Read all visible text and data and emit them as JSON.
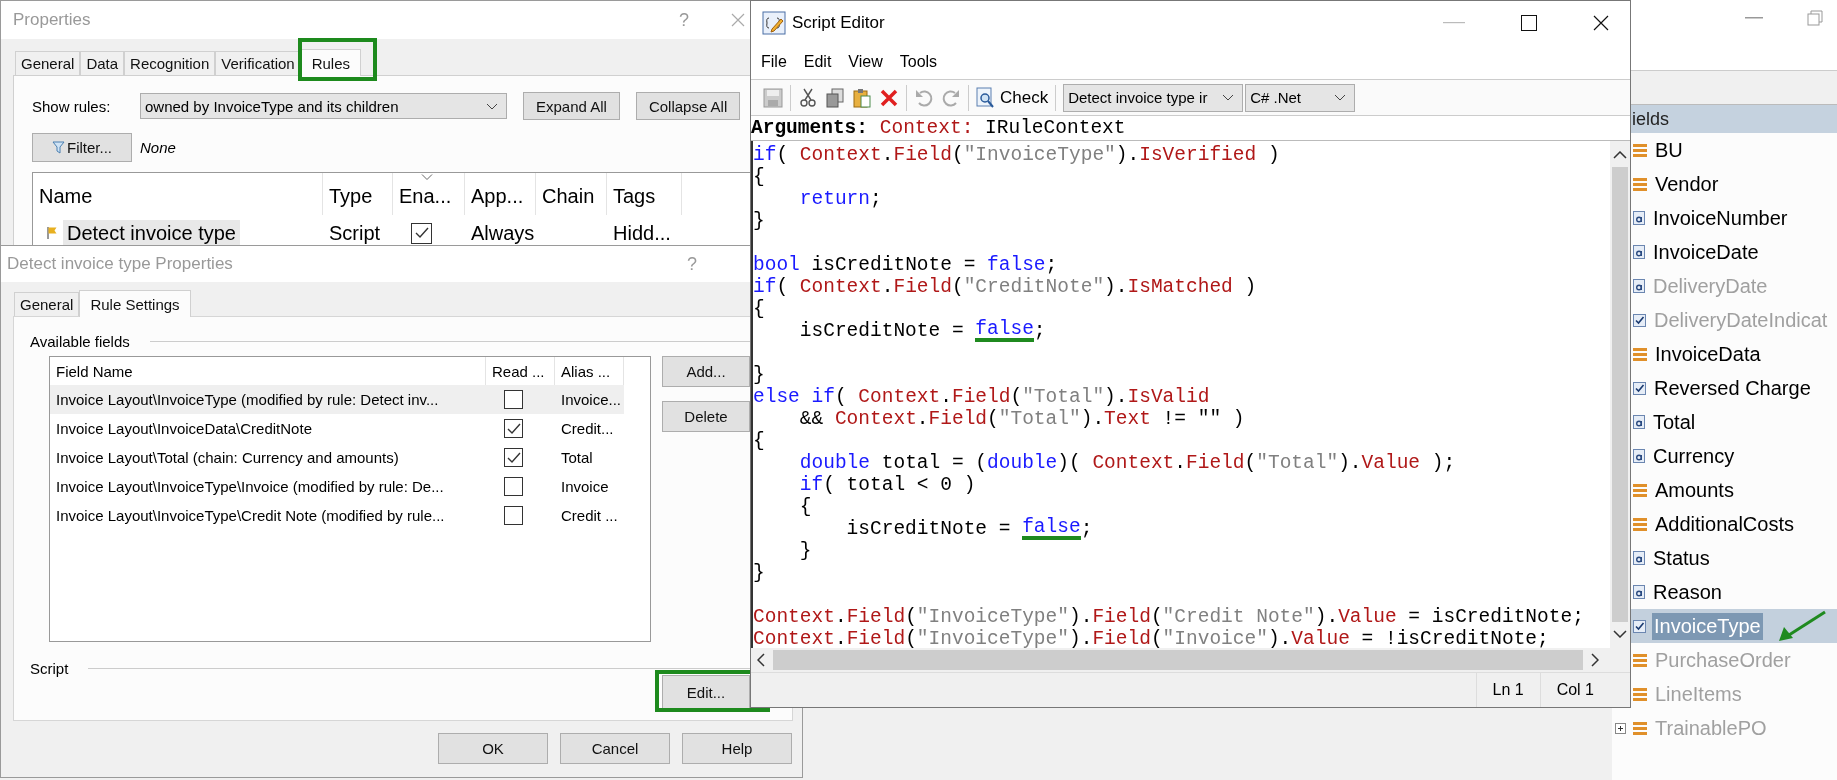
{
  "properties_window": {
    "title": "Properties",
    "help": "?",
    "tabs": [
      {
        "label": "General",
        "selected": false,
        "highlighted": false
      },
      {
        "label": "Data",
        "selected": false,
        "highlighted": false
      },
      {
        "label": "Recognition",
        "selected": false,
        "highlighted": false
      },
      {
        "label": "Verification",
        "selected": false,
        "highlighted": false
      },
      {
        "label": "Rules",
        "selected": true,
        "highlighted": true
      }
    ],
    "show_rules_label": "Show rules:",
    "show_rules_value": "owned by InvoiceType and its children",
    "buttons": [
      "Expand All",
      "Collapse All"
    ],
    "filter_button": "Filter...",
    "filter_value": "None",
    "rules_table": {
      "columns": [
        {
          "label": "Name",
          "sorted": false
        },
        {
          "label": "Type",
          "sorted": false
        },
        {
          "label": "Ena...",
          "sorted": true
        },
        {
          "label": "App...",
          "sorted": false
        },
        {
          "label": "Chain",
          "sorted": false
        },
        {
          "label": "Tags",
          "sorted": false
        }
      ],
      "rows": [
        {
          "name": "Detect invoice type",
          "type": "Script",
          "enabled": true,
          "applies": "Always",
          "tags": "Hidd...",
          "selected": true
        }
      ]
    }
  },
  "detect_dialog": {
    "title": "Detect invoice type Properties",
    "help": "?",
    "tabs": [
      {
        "label": "General",
        "selected": false
      },
      {
        "label": "Rule Settings",
        "selected": true
      }
    ],
    "available_fields_label": "Available fields",
    "fields_table": {
      "columns": [
        "Field Name",
        "Read ...",
        "Alias ..."
      ],
      "rows": [
        {
          "field_name": "Invoice Layout\\InvoiceType (modified by rule: Detect inv...",
          "read_only": false,
          "alias": "Invoice...",
          "selected": true
        },
        {
          "field_name": "Invoice Layout\\InvoiceData\\CreditNote",
          "read_only": true,
          "alias": "Credit...",
          "selected": false
        },
        {
          "field_name": "Invoice Layout\\Total (chain: Currency and amounts)",
          "read_only": true,
          "alias": "Total",
          "selected": false
        },
        {
          "field_name": "Invoice Layout\\InvoiceType\\Invoice (modified by rule: De...",
          "read_only": false,
          "alias": "Invoice",
          "selected": false
        },
        {
          "field_name": "Invoice Layout\\InvoiceType\\Credit Note (modified by rule...",
          "read_only": false,
          "alias": "Credit ...",
          "selected": false
        }
      ]
    },
    "add_button": "Add...",
    "delete_button": "Delete",
    "script_label": "Script",
    "edit_button": {
      "label": "Edit...",
      "highlighted": true
    },
    "footer_buttons": [
      "OK",
      "Cancel",
      "Help"
    ]
  },
  "script_editor": {
    "title": "Script Editor",
    "menu": [
      "File",
      "Edit",
      "View",
      "Tools"
    ],
    "check_button": "Check",
    "rule_dropdown": "Detect invoice type ir",
    "language_dropdown": "C# .Net",
    "arguments": {
      "label": "Arguments:",
      "name": "Context:",
      "type": "IRuleContext"
    },
    "code_lines": [
      {
        "kind": "code",
        "tokens": [
          {
            "kind": "kw",
            "text": "if"
          },
          {
            "kind": "plain",
            "text": "( "
          },
          {
            "kind": "member",
            "text": "Context"
          },
          {
            "kind": "plain",
            "text": "."
          },
          {
            "kind": "member",
            "text": "Field"
          },
          {
            "kind": "plain",
            "text": "("
          },
          {
            "kind": "str",
            "text": "\"InvoiceType\""
          },
          {
            "kind": "plain",
            "text": ")."
          },
          {
            "kind": "member",
            "text": "IsVerified"
          },
          {
            "kind": "plain",
            "text": " )"
          }
        ]
      },
      {
        "kind": "code",
        "tokens": [
          {
            "kind": "plain",
            "text": "{"
          }
        ]
      },
      {
        "kind": "code",
        "tokens": [
          {
            "kind": "kw",
            "text": "    return"
          },
          {
            "kind": "plain",
            "text": ";"
          }
        ]
      },
      {
        "kind": "code",
        "tokens": [
          {
            "kind": "plain",
            "text": "}"
          }
        ]
      },
      {
        "kind": "blank"
      },
      {
        "kind": "code",
        "tokens": [
          {
            "kind": "kw",
            "text": "bool"
          },
          {
            "kind": "plain",
            "text": " isCreditNote = "
          },
          {
            "kind": "kw",
            "text": "false"
          },
          {
            "kind": "plain",
            "text": ";"
          }
        ]
      },
      {
        "kind": "code",
        "tokens": [
          {
            "kind": "kw",
            "text": "if"
          },
          {
            "kind": "plain",
            "text": "( "
          },
          {
            "kind": "member",
            "text": "Context"
          },
          {
            "kind": "plain",
            "text": "."
          },
          {
            "kind": "member",
            "text": "Field"
          },
          {
            "kind": "plain",
            "text": "("
          },
          {
            "kind": "str",
            "text": "\"CreditNote\""
          },
          {
            "kind": "plain",
            "text": ")."
          },
          {
            "kind": "member",
            "text": "IsMatched"
          },
          {
            "kind": "plain",
            "text": " )"
          }
        ]
      },
      {
        "kind": "code",
        "tokens": [
          {
            "kind": "plain",
            "text": "{"
          }
        ]
      },
      {
        "kind": "code",
        "tokens": [
          {
            "kind": "plain",
            "text": "    isCreditNote = "
          },
          {
            "kind": "kw_marked",
            "text": "false"
          },
          {
            "kind": "plain",
            "text": ";"
          }
        ]
      },
      {
        "kind": "blank"
      },
      {
        "kind": "code",
        "tokens": [
          {
            "kind": "plain",
            "text": "}"
          }
        ]
      },
      {
        "kind": "code",
        "tokens": [
          {
            "kind": "kw",
            "text": "else if"
          },
          {
            "kind": "plain",
            "text": "( "
          },
          {
            "kind": "member",
            "text": "Context"
          },
          {
            "kind": "plain",
            "text": "."
          },
          {
            "kind": "member",
            "text": "Field"
          },
          {
            "kind": "plain",
            "text": "("
          },
          {
            "kind": "str",
            "text": "\"Total\""
          },
          {
            "kind": "plain",
            "text": ")."
          },
          {
            "kind": "member",
            "text": "IsValid"
          }
        ]
      },
      {
        "kind": "code",
        "tokens": [
          {
            "kind": "plain",
            "text": "    && "
          },
          {
            "kind": "member",
            "text": "Context"
          },
          {
            "kind": "plain",
            "text": "."
          },
          {
            "kind": "member",
            "text": "Field"
          },
          {
            "kind": "plain",
            "text": "("
          },
          {
            "kind": "str",
            "text": "\"Total\""
          },
          {
            "kind": "plain",
            "text": ")."
          },
          {
            "kind": "member",
            "text": "Text"
          },
          {
            "kind": "plain",
            "text": " != \"\" )"
          }
        ]
      },
      {
        "kind": "code",
        "tokens": [
          {
            "kind": "plain",
            "text": "{"
          }
        ]
      },
      {
        "kind": "code",
        "tokens": [
          {
            "kind": "kw",
            "text": "    double"
          },
          {
            "kind": "plain",
            "text": " total = ("
          },
          {
            "kind": "kw",
            "text": "double"
          },
          {
            "kind": "plain",
            "text": ")( "
          },
          {
            "kind": "member",
            "text": "Context"
          },
          {
            "kind": "plain",
            "text": "."
          },
          {
            "kind": "member",
            "text": "Field"
          },
          {
            "kind": "plain",
            "text": "("
          },
          {
            "kind": "str",
            "text": "\"Total\""
          },
          {
            "kind": "plain",
            "text": ")."
          },
          {
            "kind": "member",
            "text": "Value"
          },
          {
            "kind": "plain",
            "text": " );"
          }
        ]
      },
      {
        "kind": "code",
        "tokens": [
          {
            "kind": "kw",
            "text": "    if"
          },
          {
            "kind": "plain",
            "text": "( total < 0 )"
          }
        ]
      },
      {
        "kind": "code",
        "tokens": [
          {
            "kind": "plain",
            "text": "    {"
          }
        ]
      },
      {
        "kind": "code",
        "tokens": [
          {
            "kind": "plain",
            "text": "        isCreditNote = "
          },
          {
            "kind": "kw_marked",
            "text": "false"
          },
          {
            "kind": "plain",
            "text": ";"
          }
        ]
      },
      {
        "kind": "code",
        "tokens": [
          {
            "kind": "plain",
            "text": "    }"
          }
        ]
      },
      {
        "kind": "code",
        "tokens": [
          {
            "kind": "plain",
            "text": "}"
          }
        ]
      },
      {
        "kind": "blank"
      },
      {
        "kind": "code",
        "tokens": [
          {
            "kind": "member",
            "text": "Context"
          },
          {
            "kind": "plain",
            "text": "."
          },
          {
            "kind": "member",
            "text": "Field"
          },
          {
            "kind": "plain",
            "text": "("
          },
          {
            "kind": "str",
            "text": "\"InvoiceType\""
          },
          {
            "kind": "plain",
            "text": ")."
          },
          {
            "kind": "member",
            "text": "Field"
          },
          {
            "kind": "plain",
            "text": "("
          },
          {
            "kind": "str",
            "text": "\"Credit Note\""
          },
          {
            "kind": "plain",
            "text": ")."
          },
          {
            "kind": "member",
            "text": "Value"
          },
          {
            "kind": "plain",
            "text": " = isCreditNote;"
          }
        ]
      },
      {
        "kind": "code",
        "tokens": [
          {
            "kind": "member",
            "text": "Context"
          },
          {
            "kind": "plain",
            "text": "."
          },
          {
            "kind": "member",
            "text": "Field"
          },
          {
            "kind": "plain",
            "text": "("
          },
          {
            "kind": "str",
            "text": "\"InvoiceType\""
          },
          {
            "kind": "plain",
            "text": ")."
          },
          {
            "kind": "member",
            "text": "Field"
          },
          {
            "kind": "plain",
            "text": "("
          },
          {
            "kind": "str",
            "text": "\"Invoice\""
          },
          {
            "kind": "plain",
            "text": ")."
          },
          {
            "kind": "member",
            "text": "Value"
          },
          {
            "kind": "plain",
            "text": " = !isCreditNote;"
          }
        ]
      }
    ],
    "status": {
      "line": "Ln 1",
      "column": "Col 1"
    }
  },
  "fields_panel": {
    "header": "ields",
    "items": [
      {
        "name": "BU",
        "kind": "group",
        "disabled": false,
        "selected": false,
        "expandable": false,
        "arrow": false
      },
      {
        "name": "Vendor",
        "kind": "group",
        "disabled": false,
        "selected": false,
        "expandable": false,
        "arrow": false
      },
      {
        "name": "InvoiceNumber",
        "kind": "text",
        "disabled": false,
        "selected": false,
        "expandable": false,
        "arrow": false
      },
      {
        "name": "InvoiceDate",
        "kind": "text",
        "disabled": false,
        "selected": false,
        "expandable": false,
        "arrow": false
      },
      {
        "name": "DeliveryDate",
        "kind": "text",
        "disabled": true,
        "selected": false,
        "expandable": false,
        "arrow": false
      },
      {
        "name": "DeliveryDateIndicat",
        "kind": "checkmark",
        "disabled": true,
        "selected": false,
        "expandable": false,
        "arrow": false
      },
      {
        "name": "InvoiceData",
        "kind": "group",
        "disabled": false,
        "selected": false,
        "expandable": false,
        "arrow": false
      },
      {
        "name": "Reversed Charge",
        "kind": "checkmark",
        "disabled": false,
        "selected": false,
        "expandable": false,
        "arrow": false
      },
      {
        "name": "Total",
        "kind": "text",
        "disabled": false,
        "selected": false,
        "expandable": false,
        "arrow": false
      },
      {
        "name": "Currency",
        "kind": "text",
        "disabled": false,
        "selected": false,
        "expandable": false,
        "arrow": false
      },
      {
        "name": "Amounts",
        "kind": "group",
        "disabled": false,
        "selected": false,
        "expandable": false,
        "arrow": false
      },
      {
        "name": "AdditionalCosts",
        "kind": "group",
        "disabled": false,
        "selected": false,
        "expandable": false,
        "arrow": false
      },
      {
        "name": "Status",
        "kind": "text",
        "disabled": false,
        "selected": false,
        "expandable": false,
        "arrow": false
      },
      {
        "name": "Reason",
        "kind": "text",
        "disabled": false,
        "selected": false,
        "expandable": false,
        "arrow": false
      },
      {
        "name": "InvoiceType",
        "kind": "checkmark",
        "disabled": false,
        "selected": true,
        "expandable": false,
        "arrow": true
      },
      {
        "name": "PurchaseOrder",
        "kind": "group",
        "disabled": true,
        "selected": false,
        "expandable": false,
        "arrow": false
      },
      {
        "name": "LineItems",
        "kind": "group",
        "disabled": true,
        "selected": false,
        "expandable": false,
        "arrow": false
      },
      {
        "name": "TrainablePO",
        "kind": "group",
        "disabled": true,
        "selected": false,
        "expandable": true,
        "arrow": false
      }
    ]
  }
}
